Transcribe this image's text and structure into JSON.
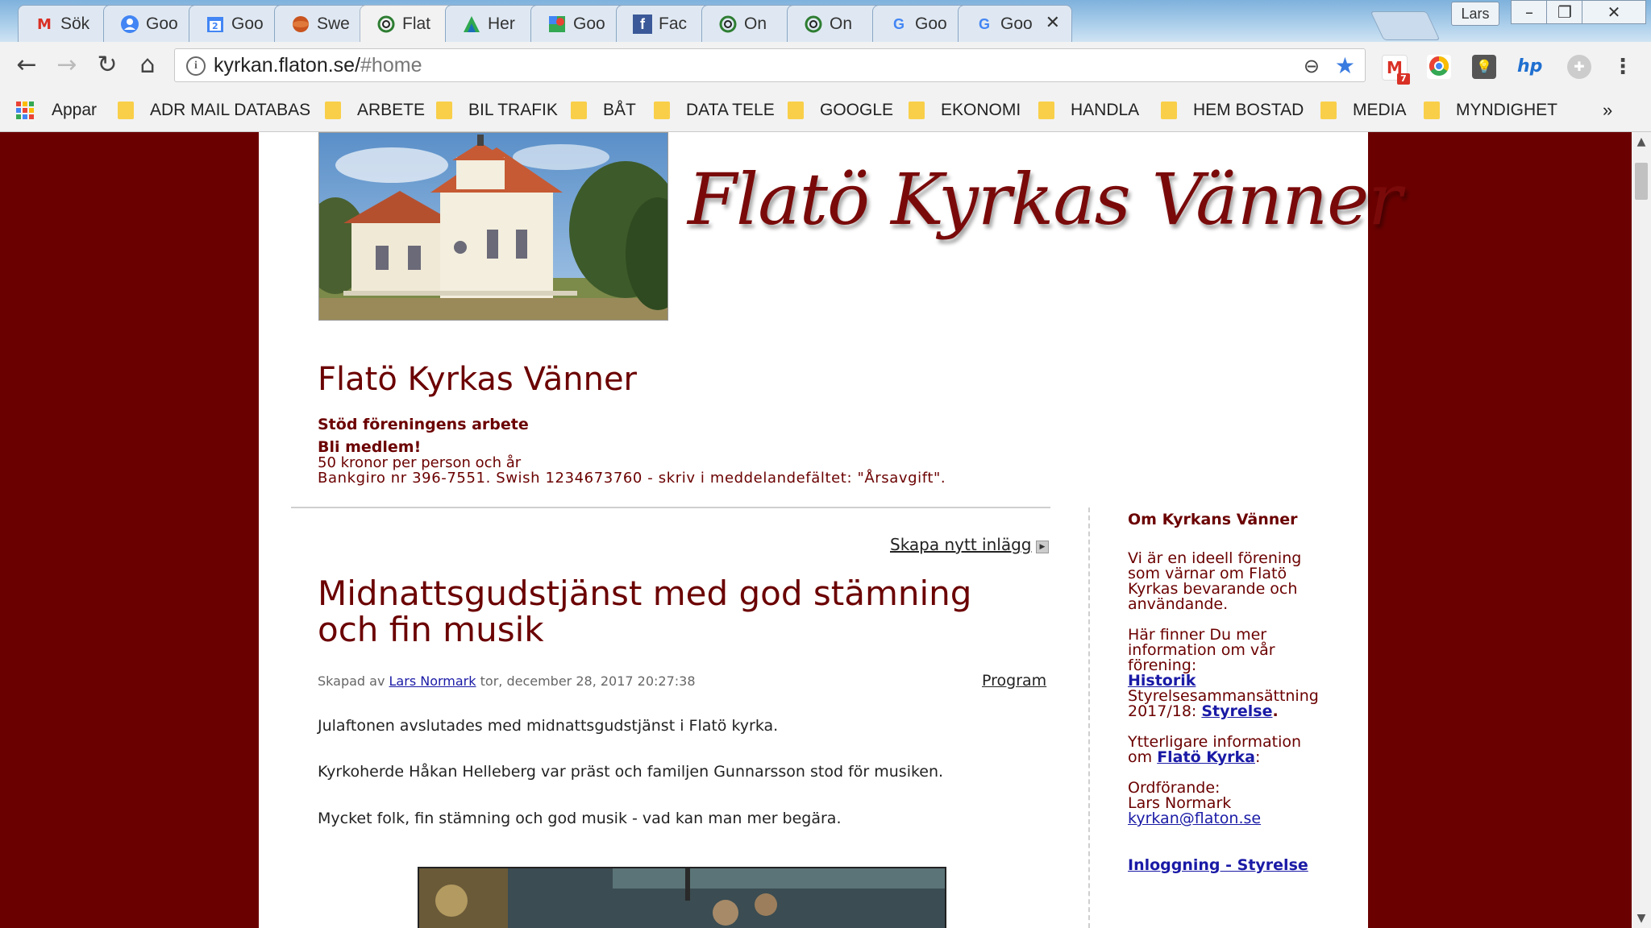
{
  "browser": {
    "tabs": [
      {
        "label": "Sök",
        "icon": "gmail-icon"
      },
      {
        "label": "Goo",
        "icon": "google-contacts-icon"
      },
      {
        "label": "Goo",
        "icon": "google-calendar-icon"
      },
      {
        "label": "Swe",
        "icon": "swedish-site-icon"
      },
      {
        "label": "Flat",
        "icon": "flaton-icon"
      },
      {
        "label": "Her",
        "icon": "green-site-icon"
      },
      {
        "label": "Goo",
        "icon": "google-maps-icon"
      },
      {
        "label": "Fac",
        "icon": "facebook-icon"
      },
      {
        "label": "On",
        "icon": "flaton-icon"
      },
      {
        "label": "On",
        "icon": "flaton-icon"
      },
      {
        "label": "Goo",
        "icon": "google-icon"
      },
      {
        "label": "Goo",
        "icon": "google-icon"
      }
    ],
    "user": "Lars",
    "url_host": "kyrkan.flaton.se/",
    "url_path": "#home",
    "gmail_badge": "7",
    "bookmarks": [
      "Appar",
      "ADR MAIL DATABAS",
      "ARBETE",
      "BIL TRAFIK",
      "BÅT",
      "DATA TELE",
      "GOOGLE",
      "EKONOMI",
      "HANDLA",
      "HEM BOSTAD",
      "MEDIA",
      "MYNDIGHET"
    ],
    "more": "»"
  },
  "header": {
    "logo_text": "Flatö Kyrkas Vänner",
    "site_title": "Flatö Kyrkas Vänner",
    "support_heading": "Stöd föreningens arbete",
    "member_heading": "Bli medlem!",
    "member_fee": "50 kronor per person och år",
    "member_payment": "Bankgiro nr 396-7551. Swish 1234673760 - skriv i meddelandefältet: \"Årsavgift\"."
  },
  "post": {
    "create_link": "Skapa nytt inlägg",
    "title": "Midnattsgudstjänst med god stämning och fin musik",
    "meta_prefix": "Skapad av",
    "author": "Lars Normark",
    "date": "tor, december 28, 2017 20:27:38",
    "category": "Program",
    "paragraphs": [
      "Julaftonen avslutades med midnattsgudstjänst i Flatö kyrka.",
      "Kyrkoherde Håkan Helleberg var präst och familjen Gunnarsson stod för musiken.",
      "Mycket folk, fin stämning och god musik - vad kan man mer begära."
    ]
  },
  "sidebar": {
    "heading": "Om Kyrkans Vänner",
    "intro": [
      "Vi är en ideell förening",
      "som värnar om Flatö",
      "Kyrkas bevarande och",
      "användande."
    ],
    "info": [
      "Här finner Du mer",
      "information om vår",
      "förening:"
    ],
    "history_link": "Historik",
    "board_label": "Styrelsesammansättning",
    "board_year": "2017/18: ",
    "board_link": "Styrelse",
    "board_dot": ".",
    "more_info": "Ytterligare information",
    "more_info_prefix": "om ",
    "church_link": "Flatö Kyrka",
    "church_suffix": ":",
    "chair_label": "Ordförande:",
    "chair_name": "Lars Normark",
    "email": "kyrkan@flaton.se",
    "login_link": "Inloggning - Styrelse"
  }
}
